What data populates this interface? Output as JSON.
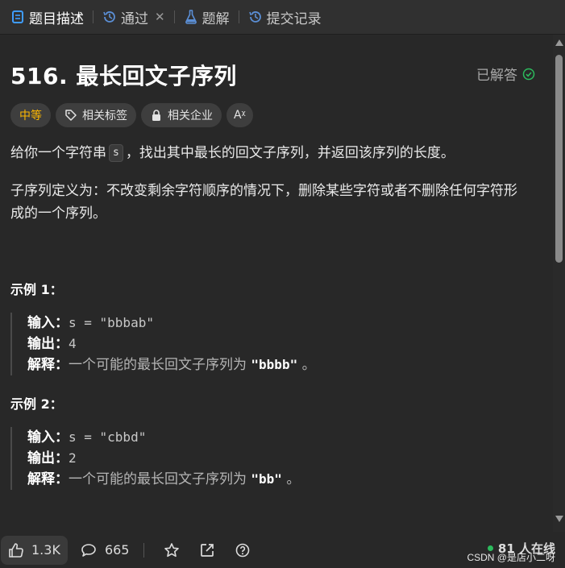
{
  "tabs": [
    {
      "label": "题目描述",
      "icon": "document-icon"
    },
    {
      "label": "通过",
      "icon": "history-icon"
    },
    {
      "label": "题解",
      "icon": "flask-icon"
    },
    {
      "label": "提交记录",
      "icon": "history-icon"
    }
  ],
  "problem": {
    "title": "516. 最长回文子序列",
    "status": "已解答",
    "difficulty": "中等",
    "tags": [
      "相关标签",
      "相关企业"
    ],
    "translate_label": "Aᵡ",
    "desc1_pre": "给你一个字符串",
    "desc1_code": "s",
    "desc1_post": "，找出其中最长的回文子序列，并返回该序列的长度。",
    "desc2_line1": "子序列定义为：不改变剩余字符顺序的情况下，删除某些字符或者不删除任何字符形",
    "desc2_line2": "成的一个序列。"
  },
  "examples": [
    {
      "heading": "示例 1：",
      "input_label": "输入：",
      "input": "s = \"bbbab\"",
      "output_label": "输出：",
      "output": "4",
      "explain_label": "解释：",
      "explain_text": "一个可能的最长回文子序列为",
      "explain_code": "\"bbbb\"",
      "explain_end": " 。"
    },
    {
      "heading": "示例 2：",
      "input_label": "输入：",
      "input": "s = \"cbbd\"",
      "output_label": "输出：",
      "output": "2",
      "explain_label": "解释：",
      "explain_text": "一个可能的最长回文子序列为",
      "explain_code": "\"bb\"",
      "explain_end": " 。"
    }
  ],
  "footer": {
    "likes": "1.3K",
    "comments": "665",
    "online": "81 人在线",
    "watermark": "CSDN @是店小二呀"
  },
  "colors": {
    "accent": "#ffb800",
    "success": "#2cbb5d",
    "tab_active_icon": "#3f9cff"
  }
}
